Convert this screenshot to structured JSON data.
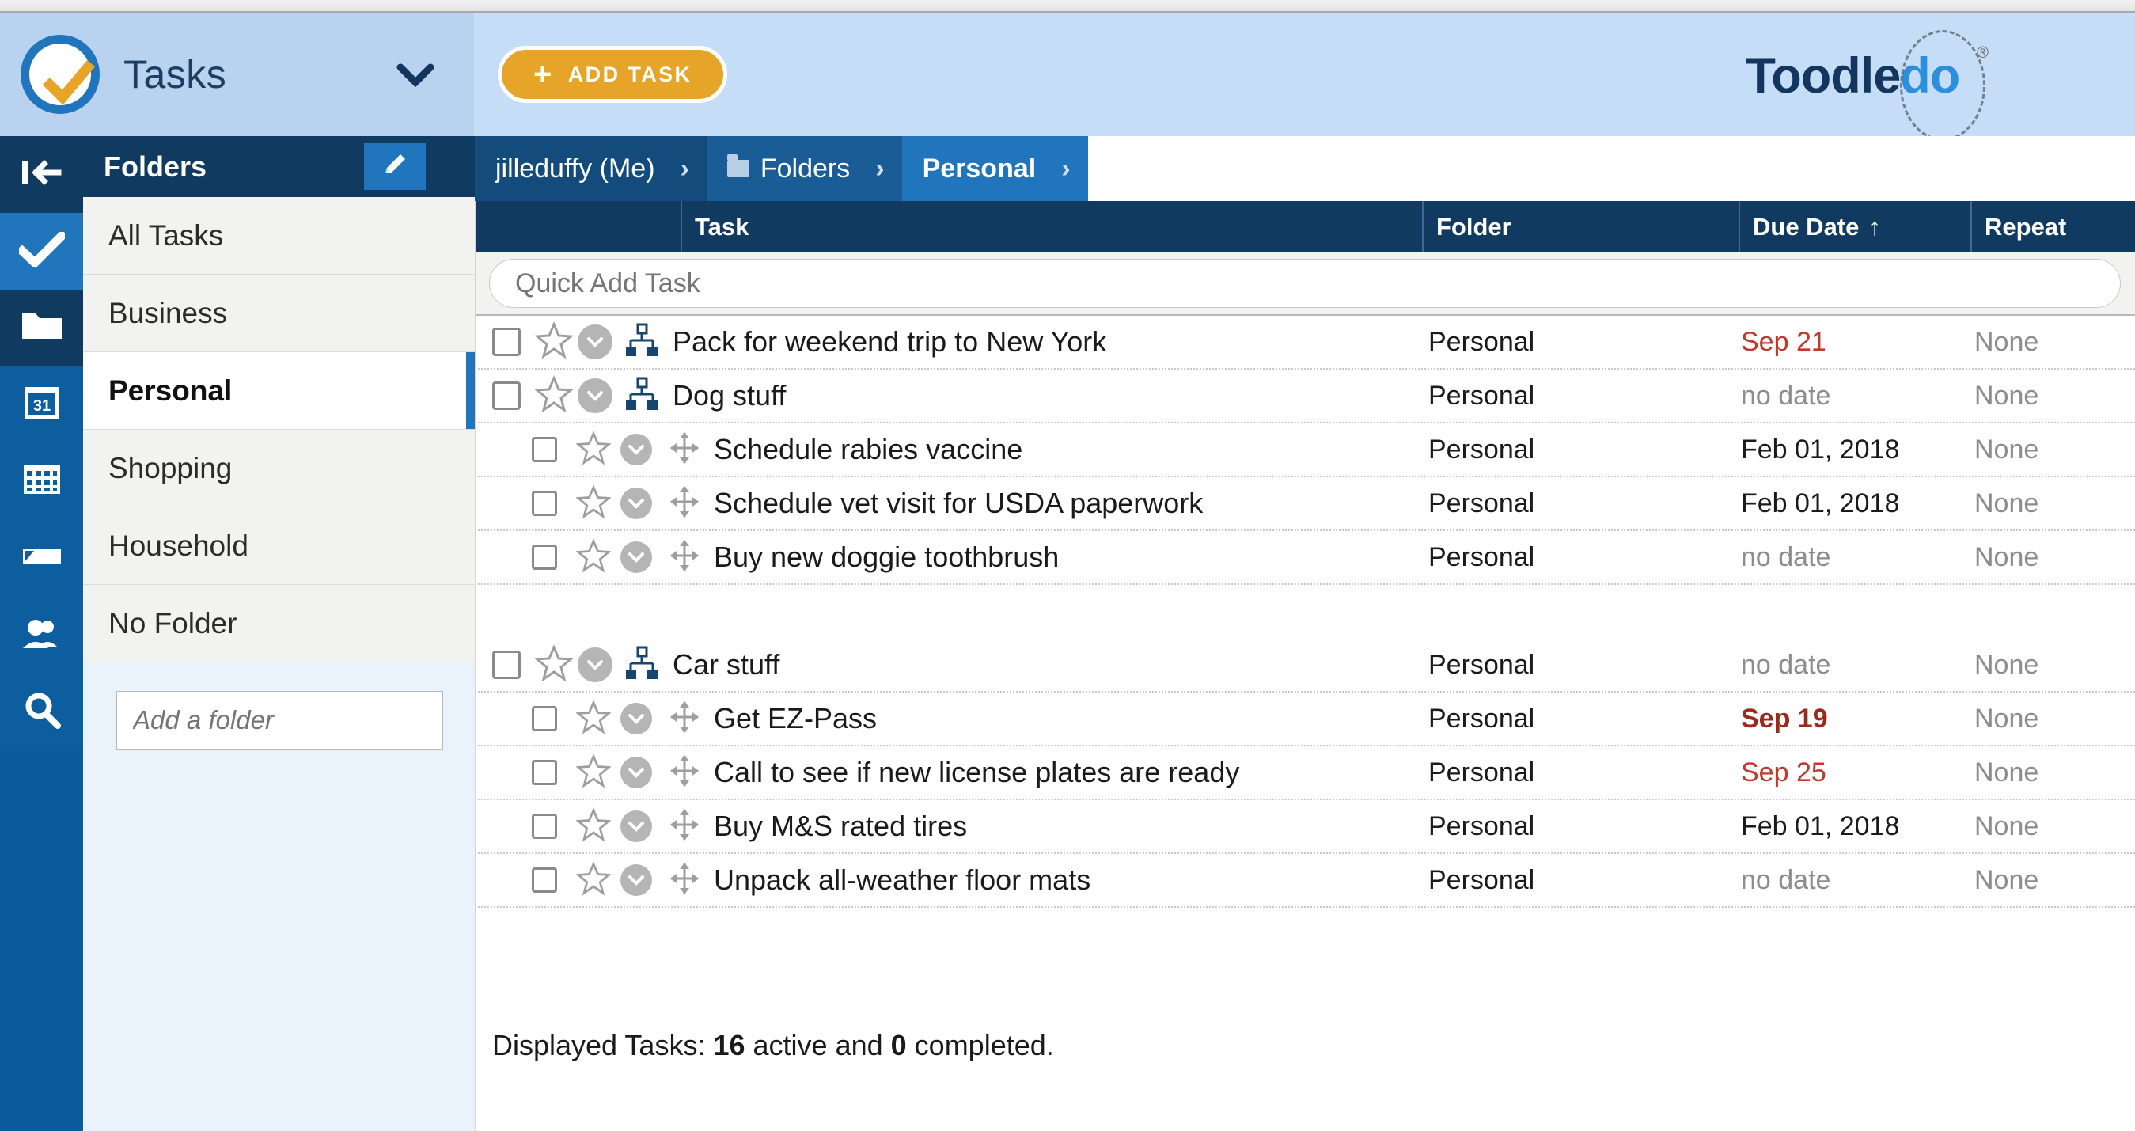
{
  "window": {
    "chrome": "browser-chrome"
  },
  "header": {
    "app_title": "Tasks",
    "app_caret_icon": "chevron-down-icon",
    "logo_icon": "check-circle-logo",
    "add_task_label": "ADD TASK",
    "add_task_plus": "+",
    "brand_part1": "Toodle",
    "brand_part2": "do",
    "brand_trademark": "®"
  },
  "rail": {
    "items": [
      {
        "name": "collapse-sidebar",
        "icon": "collapse-left-icon",
        "state": "dark"
      },
      {
        "name": "tasks",
        "icon": "check-icon",
        "state": "light"
      },
      {
        "name": "folders",
        "icon": "folder-icon",
        "state": "dark"
      },
      {
        "name": "calendar",
        "icon": "calendar-31-icon",
        "state": "mid"
      },
      {
        "name": "grid",
        "icon": "grid-icon",
        "state": "mid"
      },
      {
        "name": "notes",
        "icon": "note-icon",
        "state": "mid"
      },
      {
        "name": "contacts",
        "icon": "people-icon",
        "state": "mid"
      },
      {
        "name": "search",
        "icon": "search-icon",
        "state": "mid"
      }
    ]
  },
  "sidebar": {
    "title": "Folders",
    "edit_icon": "pencil-icon",
    "items": [
      {
        "label": "All Tasks",
        "active": false
      },
      {
        "label": "Business",
        "active": false
      },
      {
        "label": "Personal",
        "active": true
      },
      {
        "label": "Shopping",
        "active": false
      },
      {
        "label": "Household",
        "active": false
      },
      {
        "label": "No Folder",
        "active": false
      }
    ],
    "add_folder_placeholder": "Add a folder"
  },
  "breadcrumb": {
    "items": [
      {
        "label": "jilleduffy (Me)",
        "icon": null,
        "bold": false
      },
      {
        "label": "Folders",
        "icon": "folder-icon",
        "bold": false
      },
      {
        "label": "Personal",
        "icon": null,
        "bold": true
      }
    ],
    "separator": "›"
  },
  "table": {
    "columns": [
      {
        "key": "task",
        "label": "Task"
      },
      {
        "key": "folder",
        "label": "Folder"
      },
      {
        "key": "due",
        "label": "Due Date",
        "sort": "↑"
      },
      {
        "key": "repeat",
        "label": "Repeat"
      }
    ],
    "quick_add_placeholder": "Quick Add Task",
    "rows": [
      {
        "title": "Pack for weekend trip to New York",
        "folder": "Personal",
        "due": "Sep 21",
        "due_style": "red",
        "repeat": "None",
        "level": 0,
        "handle_icon": "sitemap-icon",
        "gap": false
      },
      {
        "title": "Dog stuff",
        "folder": "Personal",
        "due": "no date",
        "due_style": "gray",
        "repeat": "None",
        "level": 0,
        "handle_icon": "sitemap-icon",
        "gap": false
      },
      {
        "title": "Schedule rabies vaccine",
        "folder": "Personal",
        "due": "Feb 01, 2018",
        "due_style": "dark",
        "repeat": "None",
        "level": 1,
        "handle_icon": "move-arrows-icon",
        "gap": false
      },
      {
        "title": "Schedule vet visit for USDA paperwork",
        "folder": "Personal",
        "due": "Feb 01, 2018",
        "due_style": "dark",
        "repeat": "None",
        "level": 1,
        "handle_icon": "move-arrows-icon",
        "gap": false
      },
      {
        "title": "Buy new doggie toothbrush",
        "folder": "Personal",
        "due": "no date",
        "due_style": "gray",
        "repeat": "None",
        "level": 1,
        "handle_icon": "move-arrows-icon",
        "gap": false
      },
      {
        "title": "",
        "folder": "",
        "due": "",
        "due_style": "gray",
        "repeat": "",
        "level": 0,
        "handle_icon": null,
        "gap": true
      },
      {
        "title": "Car stuff",
        "folder": "Personal",
        "due": "no date",
        "due_style": "gray",
        "repeat": "None",
        "level": 0,
        "handle_icon": "sitemap-icon",
        "gap": false
      },
      {
        "title": "Get EZ-Pass",
        "folder": "Personal",
        "due": "Sep 19",
        "due_style": "red bold",
        "repeat": "None",
        "level": 1,
        "handle_icon": "move-arrows-icon",
        "gap": false
      },
      {
        "title": "Call to see if new license plates are ready",
        "folder": "Personal",
        "due": "Sep 25",
        "due_style": "red",
        "repeat": "None",
        "level": 1,
        "handle_icon": "move-arrows-icon",
        "gap": false
      },
      {
        "title": "Buy M&S rated tires",
        "folder": "Personal",
        "due": "Feb 01, 2018",
        "due_style": "dark",
        "repeat": "None",
        "level": 1,
        "handle_icon": "move-arrows-icon",
        "gap": false
      },
      {
        "title": "Unpack all-weather floor mats",
        "folder": "Personal",
        "due": "no date",
        "due_style": "gray",
        "repeat": "None",
        "level": 1,
        "handle_icon": "move-arrows-icon",
        "gap": false
      }
    ]
  },
  "footer": {
    "prefix": "Displayed Tasks: ",
    "active_count": "16",
    "middle": " active and ",
    "completed_count": "0",
    "suffix": " completed."
  },
  "colors": {
    "brand_navy": "#13365f",
    "brand_blue": "#2b8fdd",
    "accent_orange": "#e6a528",
    "header_dark": "#113a60",
    "rail_blue": "#0a5c9b",
    "overdue_red": "#c0392b",
    "muted_gray": "#8c8c8c"
  }
}
